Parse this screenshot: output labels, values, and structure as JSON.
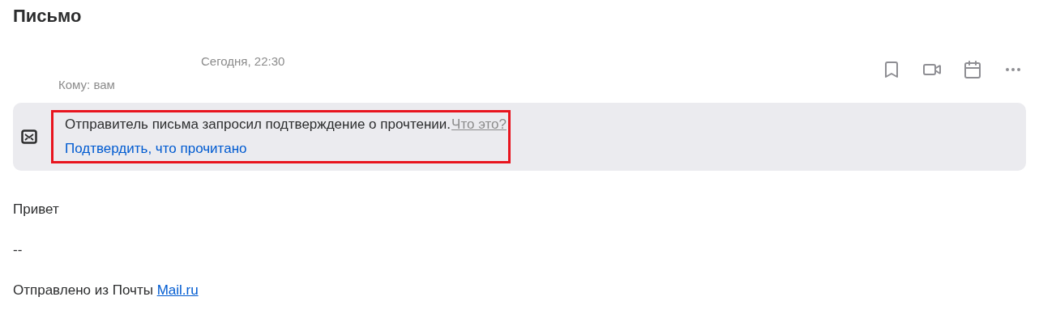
{
  "title": "Письмо",
  "meta": {
    "date": "Сегодня, 22:30",
    "recipient": "Кому: вам"
  },
  "notice": {
    "message": "Отправитель письма запросил подтверждение о прочтении.",
    "help_link": "Что это?",
    "confirm_link": "Подтвердить, что прочитано",
    "highlighted": true
  },
  "body": [
    {
      "kind": "text",
      "text": "Привет"
    },
    {
      "kind": "text",
      "text": "--"
    },
    {
      "kind": "link_line",
      "text": "Отправлено из Почты",
      "link": "Mail.ru"
    }
  ]
}
